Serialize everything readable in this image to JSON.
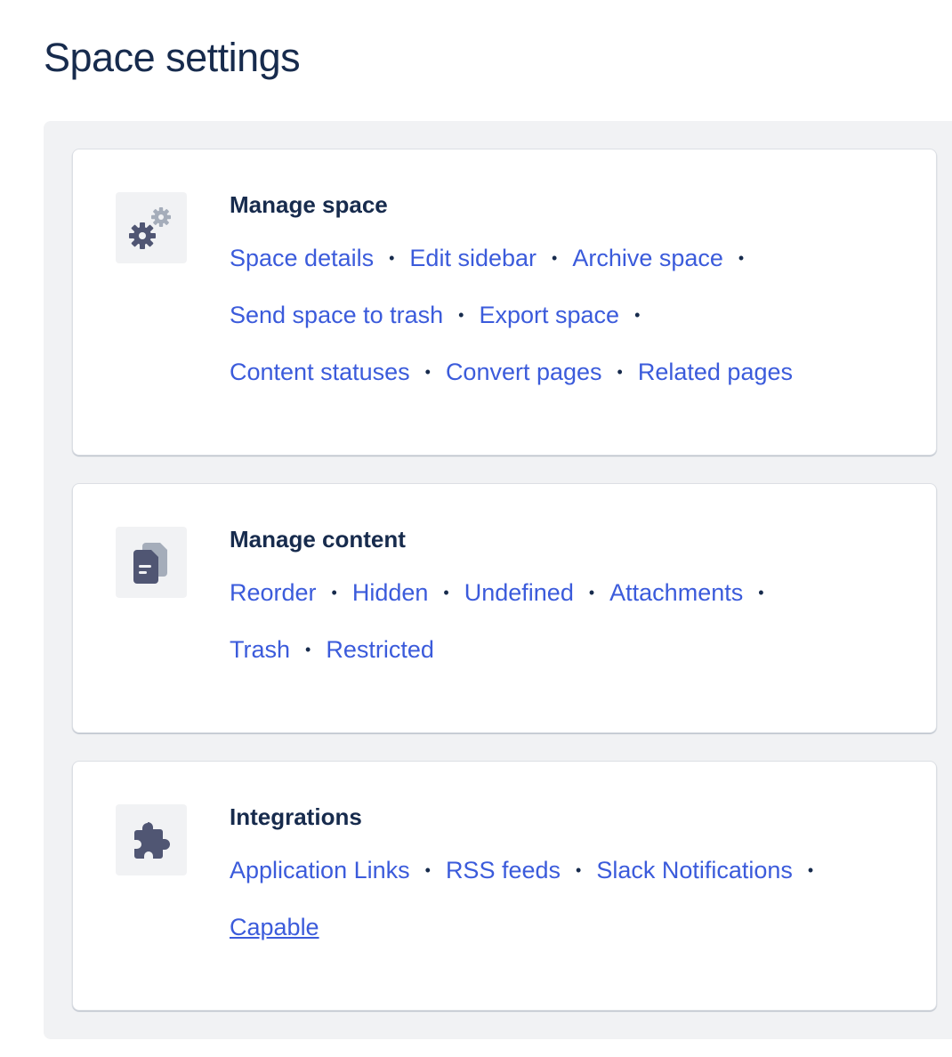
{
  "page": {
    "title": "Space settings"
  },
  "colors": {
    "link": "#3b5bdb",
    "text": "#172b4d",
    "panel": "#f1f2f4",
    "icon": "#505673"
  },
  "sections": [
    {
      "title": "Manage space",
      "icon": "gears-icon",
      "links": [
        "Space details",
        "Edit sidebar",
        "Archive space",
        "Send space to trash",
        "Export space",
        "Content statuses",
        "Convert pages",
        "Related pages"
      ]
    },
    {
      "title": "Manage content",
      "icon": "documents-icon",
      "links": [
        "Reorder",
        "Hidden",
        "Undefined",
        "Attachments",
        "Trash",
        "Restricted"
      ]
    },
    {
      "title": "Integrations",
      "icon": "puzzle-icon",
      "links": [
        "Application Links",
        "RSS feeds",
        "Slack Notifications",
        "Capable"
      ]
    }
  ]
}
